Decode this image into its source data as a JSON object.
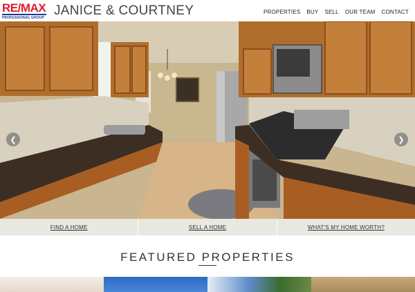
{
  "header": {
    "logo": {
      "mark_left": "RE",
      "mark_slash": "/",
      "mark_right": "MAX",
      "subtitle": "PROFESSIONAL GROUP",
      "colors": {
        "red": "#dc1c2e",
        "blue": "#1a3c8f"
      }
    },
    "brand_name": "JANICE & COURTNEY",
    "nav": [
      "PROPERTIES",
      "BUY",
      "SELL",
      "OUR TEAM",
      "CONTACT"
    ]
  },
  "hero": {
    "image": "kitchen-photo",
    "prev_icon": "chevron-left-icon",
    "next_icon": "chevron-right-icon",
    "prev_glyph": "❮",
    "next_glyph": "❯"
  },
  "quick_links": [
    "FIND A HOME",
    "SELL A HOME",
    "WHAT'S MY HOME WORTH?"
  ],
  "featured": {
    "title": "FEATURED PROPERTIES"
  },
  "colors": {
    "quick_bar_bg": "#e9e8e1",
    "text": "#333333"
  }
}
